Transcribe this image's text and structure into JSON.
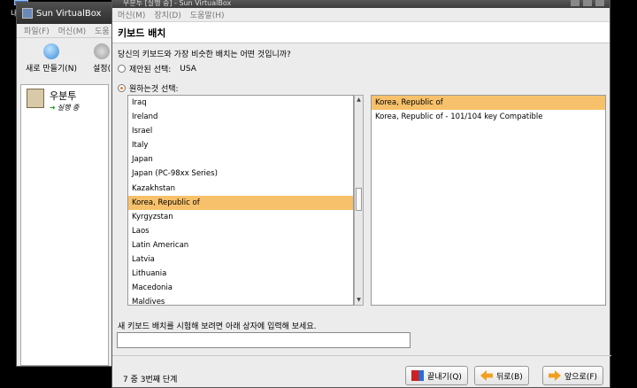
{
  "desktop": {
    "icon_label": "내"
  },
  "vbox": {
    "title": "Sun VirtualBox",
    "menu": [
      "파일(F)",
      "머신(M)",
      "도움"
    ],
    "toolbar": {
      "new_label": "새로 만들기(N)",
      "settings_label": "설정("
    },
    "vm": {
      "name": "우분투",
      "state": "실행 중"
    }
  },
  "dialog": {
    "title": "우분투 [실행 중] - Sun VirtualBox",
    "menu": [
      "머신(M)",
      "장치(D)",
      "도움말(H)"
    ],
    "heading": "키보드 배치",
    "question": "당신의 키보드와 가장 비슷한 배치는 어떤 것입니까?",
    "option_suggested": {
      "label": "제안된 선택:",
      "value": "USA"
    },
    "option_custom": {
      "label": "원하는것 선택:"
    },
    "countries": [
      "Iraq",
      "Ireland",
      "Israel",
      "Italy",
      "Japan",
      "Japan (PC-98xx Series)",
      "Kazakhstan",
      "Korea, Republic of",
      "Kyrgyzstan",
      "Laos",
      "Latin American",
      "Latvia",
      "Lithuania",
      "Macedonia",
      "Maldives"
    ],
    "selected_country": "Korea, Republic of",
    "layouts": [
      "Korea, Republic of",
      "Korea, Republic of - 101/104 key Compatible"
    ],
    "selected_layout": "Korea, Republic of",
    "test_label": "새 키보드 배치를 시험해 보려면 아래 상자에 입력해 보세요.",
    "test_value": "",
    "step": "7 중 3번째 단계",
    "buttons": {
      "quit": "끝내기(Q)",
      "back": "뒤로(B)",
      "forward": "앞으로(F)"
    }
  }
}
